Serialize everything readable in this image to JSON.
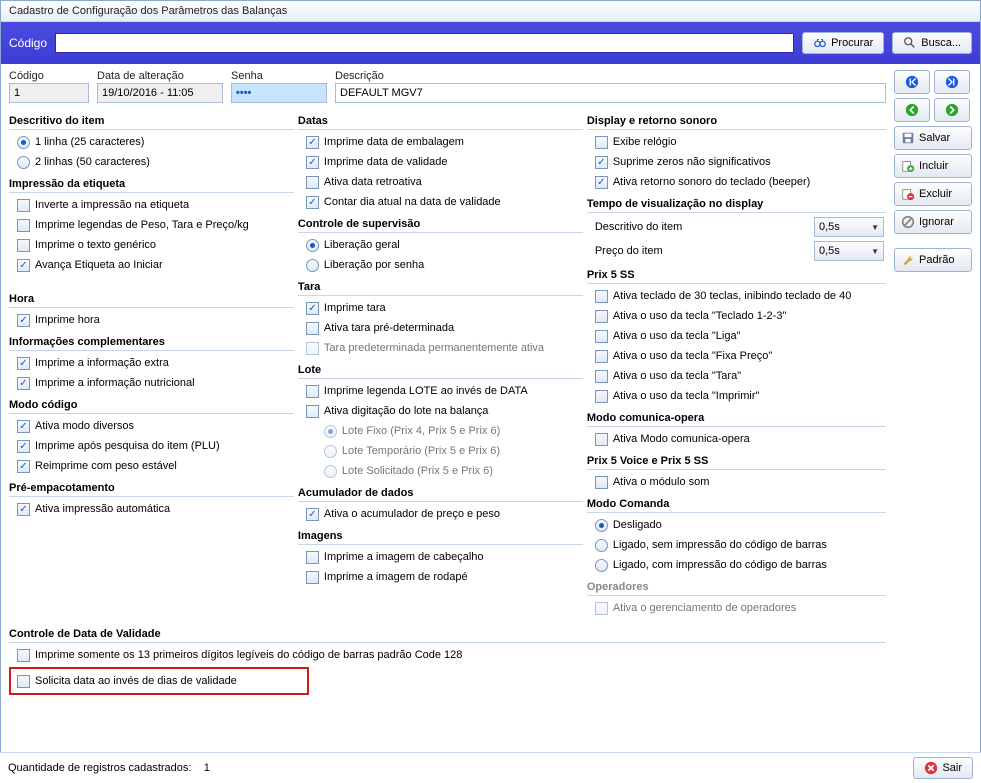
{
  "window": {
    "title": "Cadastro de Configuração dos Parâmetros das Balanças"
  },
  "searchbar": {
    "codigo_label": "Código",
    "codigo_value": "",
    "procurar": "Procurar",
    "busca": "Busca..."
  },
  "fields": {
    "codigo_label": "Código",
    "codigo_value": "1",
    "data_label": "Data de alteração",
    "data_value": "19/10/2016 - 11:05",
    "senha_label": "Senha",
    "senha_value": "••••",
    "descricao_label": "Descrição",
    "descricao_value": "DEFAULT MGV7"
  },
  "side": {
    "salvar": "Salvar",
    "incluir": "Incluir",
    "excluir": "Excluir",
    "ignorar": "Ignorar",
    "padrao": "Padrão",
    "sair": "Sair"
  },
  "col1": {
    "descritivo_head": "Descritivo do item",
    "linha1": "1 linha (25 caracteres)",
    "linha2": "2 linhas (50 caracteres)",
    "impressao_head": "Impressão da etiqueta",
    "inverte": "Inverte a impressão na etiqueta",
    "legendas": "Imprime legendas de Peso, Tara e Preço/kg",
    "texto_gen": "Imprime o texto genérico",
    "avanca": "Avança Etiqueta ao Iniciar",
    "hora_head": "Hora",
    "imprime_hora": "Imprime hora",
    "info_head": "Informações complementares",
    "info_extra": "Imprime a informação extra",
    "info_nutri": "Imprime a informação nutricional",
    "modo_head": "Modo código",
    "modo_div": "Ativa modo diversos",
    "imprime_apos": "Imprime após pesquisa do item (PLU)",
    "reimprime": "Reimprime com peso estável",
    "pre_head": "Pré-empacotamento",
    "pre_auto": "Ativa impressão automática"
  },
  "col2": {
    "datas_head": "Datas",
    "data_emb": "Imprime data de embalagem",
    "data_val": "Imprime data de validade",
    "data_retro": "Ativa data retroativa",
    "contar_dia": "Contar dia atual na data de validade",
    "controle_head": "Controle de supervisão",
    "lib_geral": "Liberação geral",
    "lib_senha": "Liberação por senha",
    "tara_head": "Tara",
    "imprime_tara": "Imprime tara",
    "tara_pre": "Ativa tara pré-determinada",
    "tara_perm": "Tara predeterminada permanentemente ativa",
    "lote_head": "Lote",
    "lote_leg": "Imprime legenda LOTE ao invés de DATA",
    "lote_dig": "Ativa digitação do lote na balança",
    "lote_fixo": "Lote Fixo (Prix 4, Prix 5 e Prix 6)",
    "lote_temp": "Lote Temporário (Prix 5 e Prix 6)",
    "lote_sol": "Lote Solicitado (Prix 5 e Prix 6)",
    "acum_head": "Acumulador de dados",
    "acum_chk": "Ativa o acumulador de preço e peso",
    "img_head": "Imagens",
    "img_cab": "Imprime a imagem de cabeçalho",
    "img_rod": "Imprime a imagem de rodapé"
  },
  "col3": {
    "display_head": "Display e retorno sonoro",
    "relogio": "Exibe relógio",
    "suprime": "Suprime zeros não significativos",
    "beeper": "Ativa retorno sonoro do teclado (beeper)",
    "tempo_head": "Tempo de visualização no display",
    "descritivo_lbl": "Descritivo do item",
    "preco_lbl": "Preço do item",
    "tempo_val": "0,5s",
    "prix5_head": "Prix 5 SS",
    "teclado30": "Ativa teclado de 30 teclas, inibindo teclado de 40",
    "tecla123": "Ativa o uso da tecla \"Teclado 1-2-3\"",
    "liga": "Ativa o uso da tecla \"Liga\"",
    "fixa": "Ativa o uso da tecla \"Fixa Preço\"",
    "tara_key": "Ativa o uso da tecla \"Tara\"",
    "impr_key": "Ativa o uso da tecla \"Imprimir\"",
    "comun_head": "Modo comunica-opera",
    "comun_chk": "Ativa Modo comunica-opera",
    "voice_head": "Prix 5 Voice e Prix 5 SS",
    "modulo_som": "Ativa o módulo som",
    "comanda_head": "Modo Comanda",
    "desligado": "Desligado",
    "ligado_sem": "Ligado, sem impressão do código de barras",
    "ligado_com": "Ligado, com impressão do código de barras",
    "oper_head": "Operadores",
    "oper_chk": "Ativa o gerenciamento de operadores"
  },
  "bottom": {
    "controle_head": "Controle de Data de Validade",
    "code128": "Imprime somente os 13 primeiros dígitos legíveis do código de barras padrão Code 128",
    "solicita": "Solicita data ao invés de dias de validade"
  },
  "footer": {
    "label": "Quantidade de registros cadastrados:",
    "count": "1"
  }
}
